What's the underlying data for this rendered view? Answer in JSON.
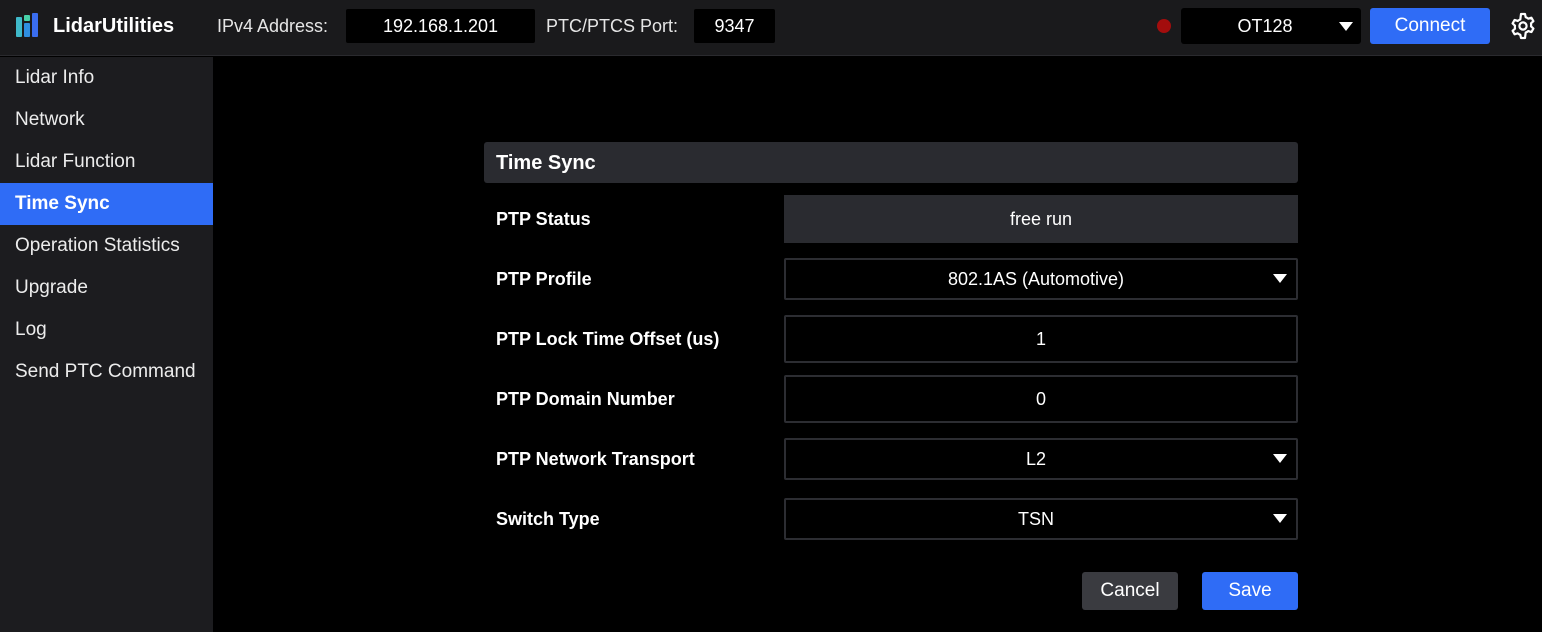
{
  "app": {
    "title": "LidarUtilities"
  },
  "topbar": {
    "ipv4_label": "IPv4 Address:",
    "ipv4_value": "192.168.1.201",
    "port_label": "PTC/PTCS Port:",
    "port_value": "9347",
    "connection_status": "disconnected",
    "status_color": "#a30d0d",
    "model_value": "OT128",
    "connect_label": "Connect",
    "settings_icon": "gear-icon"
  },
  "sidebar": {
    "items": [
      {
        "label": "Lidar Info"
      },
      {
        "label": "Network"
      },
      {
        "label": "Lidar Function"
      },
      {
        "label": "Time Sync",
        "active": true
      },
      {
        "label": "Operation Statistics"
      },
      {
        "label": "Upgrade"
      },
      {
        "label": "Log"
      },
      {
        "label": "Send PTC Command"
      }
    ]
  },
  "time_sync": {
    "title": "Time Sync",
    "ptp_status": {
      "label": "PTP Status",
      "value": "free run"
    },
    "ptp_profile": {
      "label": "PTP Profile",
      "value": "802.1AS (Automotive)"
    },
    "ptp_lock_offset": {
      "label": "PTP Lock Time Offset (us)",
      "value": "1"
    },
    "ptp_domain": {
      "label": "PTP Domain Number",
      "value": "0"
    },
    "ptp_transport": {
      "label": "PTP Network Transport",
      "value": "L2"
    },
    "switch_type": {
      "label": "Switch Type",
      "value": "TSN"
    },
    "cancel_label": "Cancel",
    "save_label": "Save"
  },
  "colors": {
    "accent": "#2f6cf6",
    "background": "#000000",
    "sidebar": "#1c1c1f",
    "topbar": "#1a1a1c"
  }
}
